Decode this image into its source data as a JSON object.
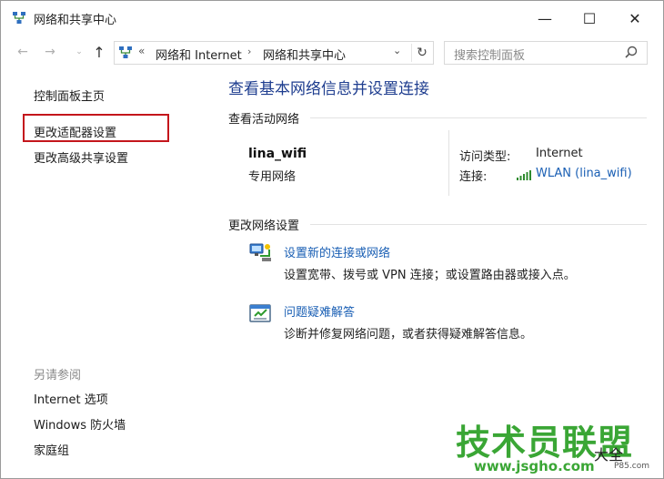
{
  "window": {
    "title": "网络和共享中心",
    "controls": {
      "minimize": "—",
      "maximize": "☐",
      "close": "✕"
    }
  },
  "navigation": {
    "back": "←",
    "forward": "→",
    "recent": "⌄",
    "up": "↑",
    "address": {
      "prefix": "«",
      "crumbs": [
        "网络和 Internet",
        "网络和共享中心"
      ],
      "separator": "›"
    },
    "search": {
      "placeholder": "搜索控制面板"
    }
  },
  "left_pane": {
    "home": "控制面板主页",
    "links": [
      "更改适配器设置",
      "更改高级共享设置"
    ],
    "highlighted_link_color": "#c4161c",
    "see_also_heading": "另请参阅",
    "see_also": [
      "Internet 选项",
      "Windows 防火墙",
      "家庭组"
    ]
  },
  "main": {
    "title": "查看基本网络信息并设置连接",
    "active_networks_heading": "查看活动网络",
    "network": {
      "name": "lina_wifi",
      "type": "专用网络",
      "access_type_label": "访问类型:",
      "access_type_value": "Internet",
      "connection_label": "连接:",
      "connection_value": "WLAN (lina_wifi)"
    },
    "change_settings_heading": "更改网络设置",
    "tasks": [
      {
        "icon": "network-setup-icon",
        "title": "设置新的连接或网络",
        "desc": "设置宽带、拨号或 VPN 连接；或设置路由器或接入点。"
      },
      {
        "icon": "troubleshoot-icon",
        "title": "问题疑难解答",
        "desc": "诊断并修复网络问题，或者获得疑难解答信息。"
      }
    ]
  },
  "watermark": {
    "main": "技术员联盟",
    "sub": "大全",
    "url": "www.jsgho.com",
    "url_small": "P85.com"
  },
  "colors": {
    "title_blue": "#1e3d8f",
    "link_blue": "#1a5fb4",
    "watermark_green": "#3aa635"
  }
}
